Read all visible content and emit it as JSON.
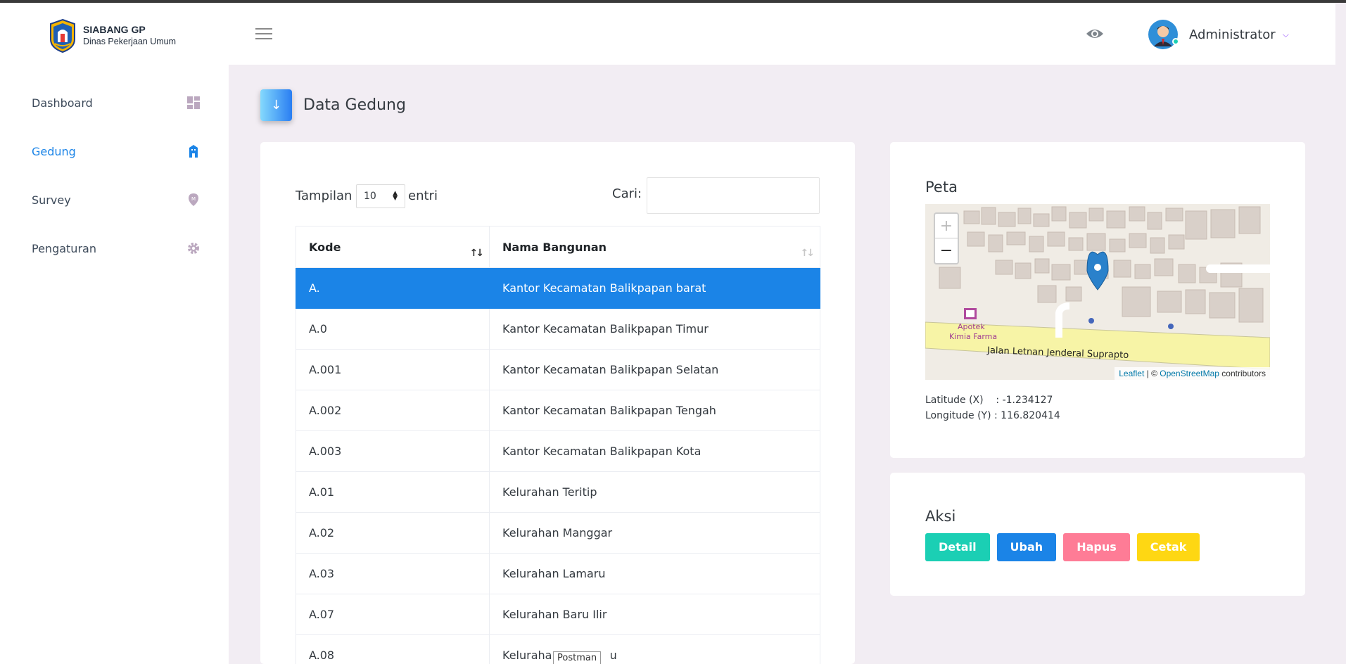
{
  "brand": {
    "title": "SIABANG GP",
    "subtitle": "Dinas Pekerjaan Umum"
  },
  "user": {
    "name": "Administrator"
  },
  "sidebar": {
    "items": [
      {
        "label": "Dashboard",
        "icon": "dashboard-icon"
      },
      {
        "label": "Gedung",
        "icon": "building-icon",
        "active": true
      },
      {
        "label": "Survey",
        "icon": "map-marker-icon"
      },
      {
        "label": "Pengaturan",
        "icon": "gear-icon"
      }
    ]
  },
  "page": {
    "title": "Data Gedung"
  },
  "table_controls": {
    "length_prefix": "Tampilan",
    "length_value": "10",
    "length_suffix": "entri",
    "search_label": "Cari:"
  },
  "table": {
    "headers": [
      "Kode",
      "Nama Bangunan"
    ],
    "rows": [
      {
        "kode": "A.",
        "nama": "Kantor Kecamatan Balikpapan barat"
      },
      {
        "kode": "A.0",
        "nama": "Kantor Kecamatan Balikpapan Timur"
      },
      {
        "kode": "A.001",
        "nama": "Kantor Kecamatan Balikpapan Selatan"
      },
      {
        "kode": "A.002",
        "nama": "Kantor Kecamatan Balikpapan Tengah"
      },
      {
        "kode": "A.003",
        "nama": "Kantor Kecamatan Balikpapan Kota"
      },
      {
        "kode": "A.01",
        "nama": "Kelurahan Teritip"
      },
      {
        "kode": "A.02",
        "nama": "Kelurahan Manggar"
      },
      {
        "kode": "A.03",
        "nama": "Kelurahan Lamaru"
      },
      {
        "kode": "A.07",
        "nama": "Kelurahan Baru Ilir"
      },
      {
        "kode": "A.08",
        "nama": "Kelurahan"
      }
    ],
    "visible_truncated_suffix": "u"
  },
  "tooltip": "Postman",
  "map_card": {
    "title": "Peta",
    "latitude_label": "Latitude (X)",
    "latitude_value": ": -1.234127",
    "longitude_label": "Longitude (Y)",
    "longitude_value": ": 116.820414",
    "map_labels": {
      "shop": "Apotek\nKimia Farma",
      "road": "Jalan Letnan Jenderal Suprapto"
    },
    "attribution": {
      "leaflet": "Leaflet",
      "sep": " | © ",
      "osm": "OpenStreetMap",
      "suffix": " contributors"
    },
    "zoom_in": "+",
    "zoom_out": "−"
  },
  "aksi_card": {
    "title": "Aksi",
    "buttons": [
      {
        "label": "Detail",
        "color": "#1bcfb4"
      },
      {
        "label": "Ubah",
        "color": "#1b84e7"
      },
      {
        "label": "Hapus",
        "color": "#fe7c96"
      },
      {
        "label": "Cetak",
        "color": "#fed713"
      }
    ]
  }
}
